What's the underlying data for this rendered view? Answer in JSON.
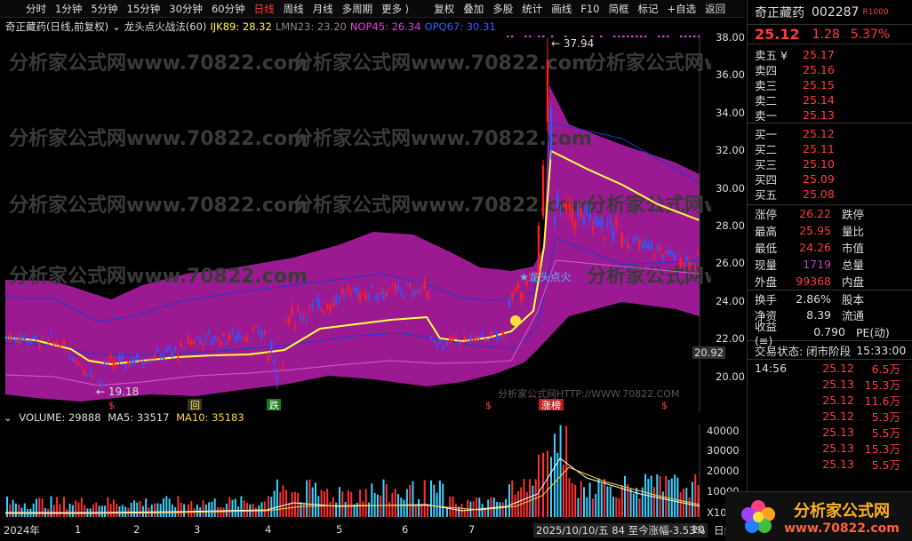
{
  "toolbar": {
    "items": [
      "分时",
      "1分钟",
      "5分钟",
      "15分钟",
      "30分钟",
      "60分钟",
      "日线",
      "周线",
      "月线",
      "多周期",
      "更多 ⟩",
      "复权",
      "叠加",
      "多股",
      "统计",
      "画线",
      "F10",
      "简框",
      "标记",
      "+自选",
      "返回"
    ],
    "active": "日线"
  },
  "title": {
    "stock": "奇正藏药(日线,前复权)",
    "indicator": "龙头点火战法(60)",
    "ijk": "IJK89: 28.32",
    "lmn": "LMN23: 23.20",
    "nop": "NOP45: 26.34",
    "opq": "OPQ67: 30.31"
  },
  "price_axis": [
    "38.00",
    "36.00",
    "34.00",
    "32.00",
    "30.00",
    "28.00",
    "26.00",
    "24.00",
    "22.00",
    "20.00"
  ],
  "annotations": {
    "high": "37.94",
    "low": "19.18",
    "signal": "★龙头点火",
    "current_price": "20.92",
    "watermark": "分析家公式网www.70822.com",
    "watermark2": "分析家公式网HTTP://WWW.70822.COM"
  },
  "markers": {
    "m1": "$",
    "m2": "回",
    "m3": "跌",
    "m4": "$",
    "m5": "$",
    "m6": "涨榜",
    "m7": "$"
  },
  "volume": {
    "label": "VOLUME: 29888",
    "ma5": "MA5: 33517",
    "ma10": "MA10: 35183",
    "axis": [
      "40000",
      "30000",
      "20000",
      "10000",
      "X10"
    ]
  },
  "dates": [
    "2024年",
    "1",
    "2",
    "3",
    "4",
    "5",
    "6",
    "7",
    "2025/10/10/五 84 至今涨幅-3.53%",
    "10",
    "日线"
  ],
  "right": {
    "name": "奇正藏药",
    "code": "002287",
    "badge": "R1000",
    "price": "25.12",
    "change": "1.28",
    "pct": "5.37%",
    "asks": [
      {
        "l": "卖五 ¥",
        "p": "25.17"
      },
      {
        "l": "卖四",
        "p": "25.16"
      },
      {
        "l": "卖三",
        "p": "25.15"
      },
      {
        "l": "卖二",
        "p": "25.14"
      },
      {
        "l": "卖一",
        "p": "25.13"
      }
    ],
    "bids": [
      {
        "l": "买一",
        "p": "25.12"
      },
      {
        "l": "买二",
        "p": "25.11"
      },
      {
        "l": "买三",
        "p": "25.10"
      },
      {
        "l": "买四",
        "p": "25.09"
      },
      {
        "l": "买五",
        "p": "25.08"
      }
    ],
    "stats": [
      {
        "l": "涨停",
        "v": "26.22",
        "c": "#ff3c3c",
        "r": "跌停"
      },
      {
        "l": "最高",
        "v": "25.95",
        "c": "#ff3c3c",
        "r": "量比"
      },
      {
        "l": "最低",
        "v": "24.26",
        "c": "#ff3c3c",
        "r": "市值"
      },
      {
        "l": "现量",
        "v": "1719",
        "c": "#c040c0",
        "r": "总量"
      },
      {
        "l": "外盘",
        "v": "99368",
        "c": "#ff3c3c",
        "r": "内盘"
      },
      {
        "l": "换手",
        "v": "2.86%",
        "c": "#ddd",
        "r": "股本"
      },
      {
        "l": "净资",
        "v": "8.39",
        "c": "#ddd",
        "r": "流通"
      },
      {
        "l": "收益(≡)",
        "v": "0.790",
        "c": "#ddd",
        "r": "PE(动)"
      }
    ],
    "status": "交易状态: 闭市阶段",
    "time": "15:33:00",
    "ticks": [
      {
        "t": "14:56",
        "p": "25.12",
        "v": "6.5万"
      },
      {
        "t": "",
        "p": "25.13",
        "v": "15.3万"
      },
      {
        "t": "",
        "p": "25.12",
        "v": "11.6万"
      },
      {
        "t": "",
        "p": "25.12",
        "v": "5.3万"
      },
      {
        "t": "",
        "p": "25.13",
        "v": "5.5万"
      },
      {
        "t": "",
        "p": "25.13",
        "v": "15.3万"
      },
      {
        "t": "",
        "p": "25.13",
        "v": "5.5万"
      }
    ]
  },
  "logo": {
    "text": "分析家公式网",
    "url": "www.70822.com"
  },
  "colors": {
    "band": "#9b1a92",
    "up": "#ff2020",
    "down": "#2b5bff",
    "yellow": "#ffff40",
    "purple": "#c040c0",
    "blue": "#1a3ad0"
  }
}
